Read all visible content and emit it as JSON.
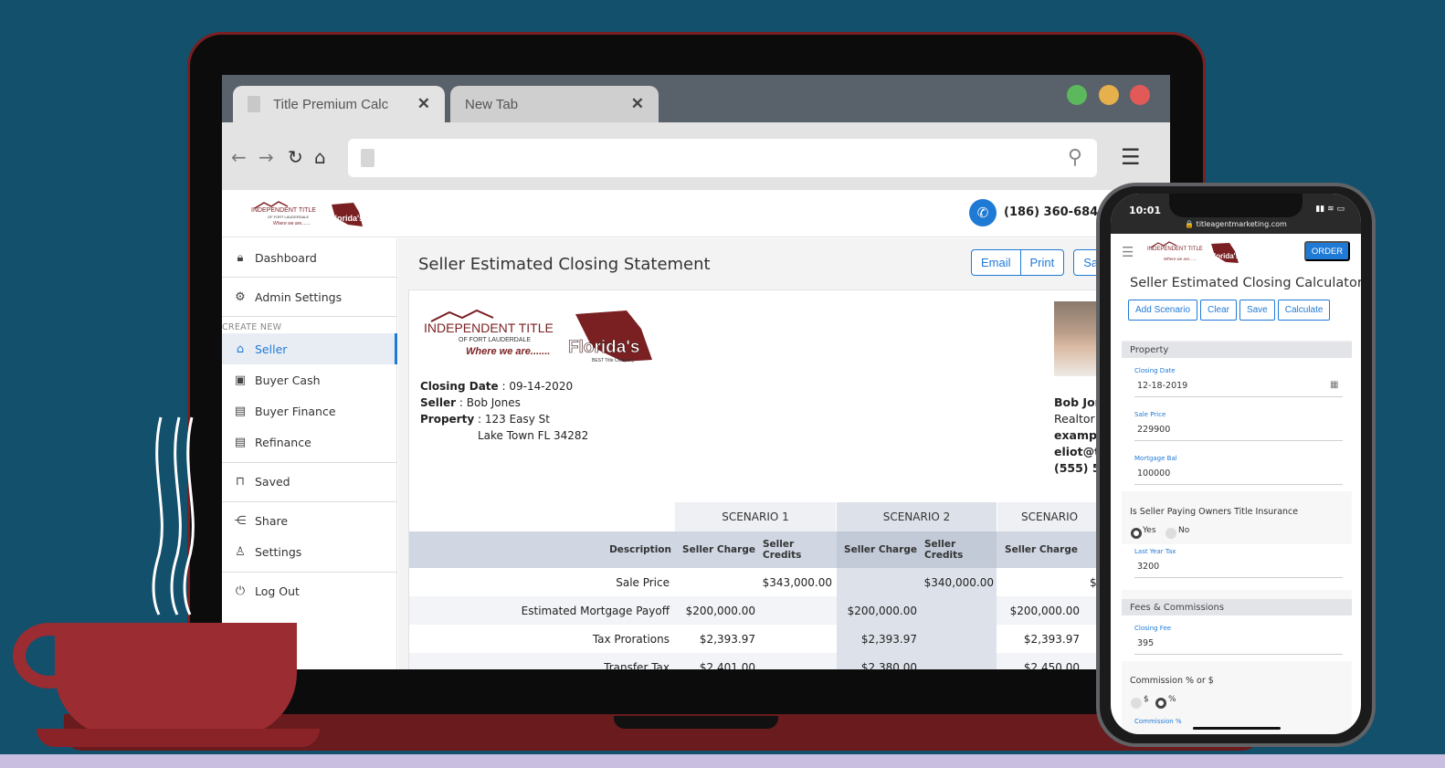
{
  "browser": {
    "tabs": [
      {
        "label": "Title Premium Calc",
        "close": "✕"
      },
      {
        "label": "New Tab",
        "close": "✕"
      }
    ],
    "window_colors": [
      "#5cb85c",
      "#e6b04c",
      "#e25a57"
    ]
  },
  "app": {
    "phone_number": "(186) 360-6843",
    "brand_color": "#1f7ad6"
  },
  "sidebar": {
    "items": [
      {
        "label": "Dashboard",
        "icon": "lock-icon"
      },
      {
        "label": "Admin Settings",
        "icon": "gear-icon"
      },
      {
        "label": "Seller",
        "icon": "seller-icon"
      },
      {
        "label": "Buyer Cash",
        "icon": "cash-icon"
      },
      {
        "label": "Buyer Finance",
        "icon": "finance-icon"
      },
      {
        "label": "Refinance",
        "icon": "refinance-icon"
      },
      {
        "label": "Saved",
        "icon": "bookmark-icon"
      },
      {
        "label": "Share",
        "icon": "share-icon"
      },
      {
        "label": "Settings",
        "icon": "user-icon"
      },
      {
        "label": "Log Out",
        "icon": "power-icon"
      }
    ],
    "section_label": "CREATE NEW"
  },
  "main": {
    "title": "Seller Estimated Closing Statement",
    "buttons": {
      "email": "Email",
      "print": "Print",
      "save": "Sa"
    },
    "info": {
      "closing_date_label": "Closing Date",
      "closing_date": " : 09-14-2020",
      "seller_label": "Seller",
      "seller": " : Bob Jones",
      "property_label": "Property",
      "property_line1": " : 123 Easy St",
      "property_line2": "Lake Town FL 34282"
    },
    "agent": {
      "name": "Bob Jon",
      "role": "Realtor",
      "site": "example",
      "email": "eliot@tit",
      "phone": "(555) 55"
    },
    "table": {
      "scenarios": [
        "SCENARIO 1",
        "SCENARIO 2",
        "SCENARIO"
      ],
      "headers": [
        "Description",
        "Seller Charge",
        "Seller Credits",
        "Seller Charge",
        "Seller Credits",
        "Seller Charge",
        "S"
      ],
      "rows": [
        {
          "desc": "Sale Price",
          "c1": "",
          "cr1": "$343,000.00",
          "c2": "",
          "cr2": "$340,000.00",
          "c3": "",
          "cr3": "$"
        },
        {
          "desc": "Estimated Mortgage Payoff",
          "c1": "$200,000.00",
          "cr1": "",
          "c2": "$200,000.00",
          "cr2": "",
          "c3": "$200,000.00",
          "cr3": ""
        },
        {
          "desc": "Tax Prorations",
          "c1": "$2,393.97",
          "cr1": "",
          "c2": "$2,393.97",
          "cr2": "",
          "c3": "$2,393.97",
          "cr3": ""
        },
        {
          "desc": "Transfer Tax",
          "c1": "$2,401.00",
          "cr1": "",
          "c2": "$2,380.00",
          "cr2": "",
          "c3": "$2,450.00",
          "cr3": ""
        }
      ]
    }
  },
  "logo": {
    "line1": "INDEPENDENT TITLE",
    "line2": "OF FORT LAUDERDALE",
    "tagline": "Where we are.......",
    "badge": "Florida's",
    "badge_sub": "BEST Title Company"
  },
  "phone": {
    "time": "10:01",
    "url": "🔒 titleagentmarketing.com",
    "order": "ORDER",
    "title": "Seller Estimated Closing Calculator",
    "buttons": [
      "Add Scenario",
      "Clear",
      "Save",
      "Calculate"
    ],
    "sections": {
      "property": "Property",
      "fees": "Fees & Commissions"
    },
    "fields": {
      "closing_date_label": "Closing Date",
      "closing_date": "12-18-2019",
      "sale_price_label": "Sale Price",
      "sale_price": "229900",
      "mortgage_label": "Mortgage Bal",
      "mortgage": "100000",
      "owners_q": "Is Seller Paying Owners Title Insurance",
      "yes": "Yes",
      "no": "No",
      "last_tax_label": "Last Year Tax",
      "last_tax": "3200",
      "closing_fee_label": "Closing Fee",
      "closing_fee": "395",
      "commission_q": "Commission % or $",
      "dollar": "$",
      "percent": "%",
      "commission_label": "Commission %"
    }
  }
}
